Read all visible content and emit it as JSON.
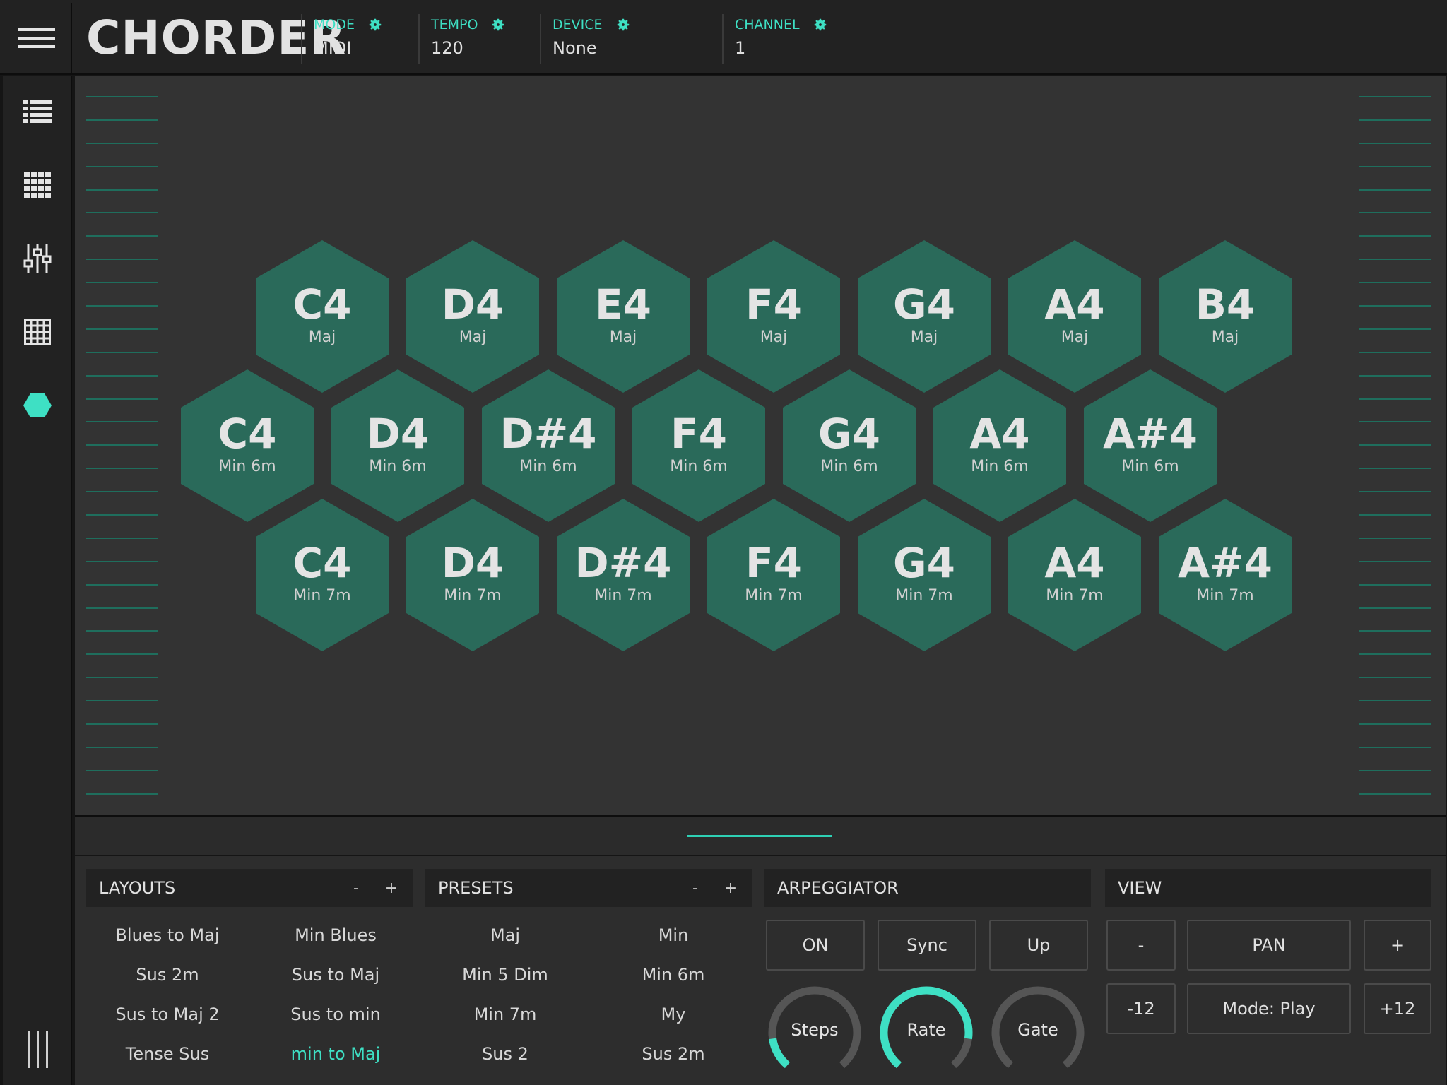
{
  "app": {
    "logo": "CHORDER",
    "accent": "#3ee0c4",
    "hex_color": "#2a6a5a"
  },
  "topbar": {
    "mode": {
      "label": "MODE",
      "value": "MIDI"
    },
    "tempo": {
      "label": "TEMPO",
      "value": "120"
    },
    "device": {
      "label": "DEVICE",
      "value": "None"
    },
    "channel": {
      "label": "CHANNEL",
      "value": "1"
    }
  },
  "sidebar": {
    "icons": [
      "list-icon",
      "grid-icon",
      "mixer-icon",
      "table-icon",
      "hexagon-icon"
    ],
    "active": "hexagon-icon"
  },
  "pads": {
    "rows": [
      [
        {
          "note": "C4",
          "quality": "Maj"
        },
        {
          "note": "D4",
          "quality": "Maj"
        },
        {
          "note": "E4",
          "quality": "Maj"
        },
        {
          "note": "F4",
          "quality": "Maj"
        },
        {
          "note": "G4",
          "quality": "Maj"
        },
        {
          "note": "A4",
          "quality": "Maj"
        },
        {
          "note": "B4",
          "quality": "Maj"
        }
      ],
      [
        {
          "note": "C4",
          "quality": "Min 6m"
        },
        {
          "note": "D4",
          "quality": "Min 6m"
        },
        {
          "note": "D#4",
          "quality": "Min 6m"
        },
        {
          "note": "F4",
          "quality": "Min 6m"
        },
        {
          "note": "G4",
          "quality": "Min 6m"
        },
        {
          "note": "A4",
          "quality": "Min 6m"
        },
        {
          "note": "A#4",
          "quality": "Min 6m"
        }
      ],
      [
        {
          "note": "C4",
          "quality": "Min 7m"
        },
        {
          "note": "D4",
          "quality": "Min 7m"
        },
        {
          "note": "D#4",
          "quality": "Min 7m"
        },
        {
          "note": "F4",
          "quality": "Min 7m"
        },
        {
          "note": "G4",
          "quality": "Min 7m"
        },
        {
          "note": "A4",
          "quality": "Min 7m"
        },
        {
          "note": "A#4",
          "quality": "Min 7m"
        }
      ]
    ]
  },
  "layouts": {
    "title": "LAYOUTS",
    "minus": "-",
    "plus": "+",
    "items": [
      "Blues to Maj",
      "Min Blues",
      "Sus 2m",
      "Sus to Maj",
      "Sus to Maj 2",
      "Sus to min",
      "Tense Sus",
      "min to Maj"
    ],
    "active": "min to Maj"
  },
  "presets": {
    "title": "PRESETS",
    "minus": "-",
    "plus": "+",
    "items": [
      "Maj",
      "Min",
      "Min 5 Dim",
      "Min 6m",
      "Min 7m",
      "My",
      "Sus 2",
      "Sus 2m"
    ]
  },
  "arpeggiator": {
    "title": "ARPEGGIATOR",
    "buttons": [
      "ON",
      "Sync",
      "Up"
    ],
    "knobs": [
      {
        "label": "Steps",
        "level": 0.15
      },
      {
        "label": "Rate",
        "level": 0.85
      },
      {
        "label": "Gate",
        "level": 0.0
      }
    ]
  },
  "view": {
    "title": "VIEW",
    "zoom_out": "-",
    "pan": "PAN",
    "zoom_in": "+",
    "octave_down": "-12",
    "mode": "Mode: Play",
    "octave_up": "+12"
  }
}
